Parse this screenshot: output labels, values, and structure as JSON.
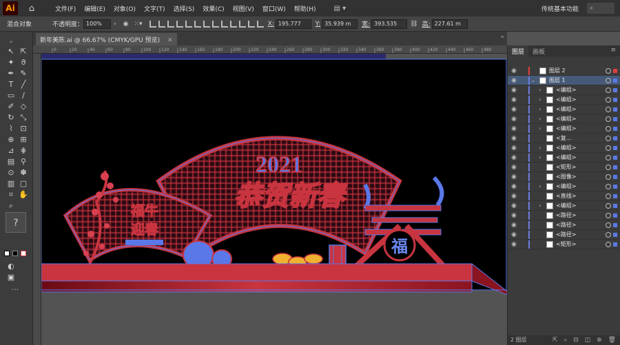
{
  "app": {
    "logo": "Ai",
    "home_icon": "home-icon"
  },
  "menu": [
    "文件(F)",
    "编辑(E)",
    "对象(O)",
    "文字(T)",
    "选择(S)",
    "效果(C)",
    "视图(V)",
    "窗口(W)",
    "帮助(H)"
  ],
  "workspace": {
    "name": "传统基本功能",
    "search_placeholder": "搜索"
  },
  "control_bar": {
    "mode": "混合对象",
    "opacity_label": "不透明度：",
    "opacity_value": "100%",
    "x_label": "X:",
    "x_value": "195.777",
    "y_label": "Y:",
    "y_value": "35.939 m",
    "w_label": "宽:",
    "w_value": "393.535",
    "h_label": "高:",
    "h_value": "227.61 m"
  },
  "document": {
    "tab_label": "新年美陈.ai @ 66.67% (CMYK/GPU 预览)"
  },
  "ruler": {
    "ticks": [
      "0",
      "20",
      "40",
      "60",
      "80",
      "100",
      "120",
      "140",
      "160",
      "180",
      "200",
      "220",
      "240",
      "260",
      "280",
      "300",
      "320",
      "340",
      "360",
      "380",
      "400",
      "420",
      "440",
      "460",
      "480"
    ]
  },
  "artwork": {
    "year": "2021",
    "greeting": "恭贺新春",
    "small_text_1": "福牛",
    "small_text_2": "迎春",
    "fu": "福",
    "colors": {
      "red": "#c8343f",
      "blue": "#5a78e8",
      "gold": "#f0b030",
      "bg": "#000000"
    }
  },
  "layers_panel": {
    "tabs": [
      "图层",
      "画板"
    ],
    "rows": [
      {
        "name": "图层 2",
        "level": 0,
        "arrow": "",
        "color": "red"
      },
      {
        "name": "图层 1",
        "level": 0,
        "arrow": "⌄",
        "color": "blue",
        "selected": true
      },
      {
        "name": "<编组>",
        "level": 1,
        "arrow": "›"
      },
      {
        "name": "<编组>",
        "level": 1,
        "arrow": "›"
      },
      {
        "name": "<编组>",
        "level": 1,
        "arrow": "›"
      },
      {
        "name": "<编组>",
        "level": 1,
        "arrow": "›"
      },
      {
        "name": "<编组>",
        "level": 1,
        "arrow": "›"
      },
      {
        "name": "<复...",
        "level": 1,
        "arrow": ""
      },
      {
        "name": "<编组>",
        "level": 1,
        "arrow": "›"
      },
      {
        "name": "<编组>",
        "level": 1,
        "arrow": "›"
      },
      {
        "name": "<矩形>",
        "level": 1,
        "arrow": ""
      },
      {
        "name": "<图像>",
        "level": 1,
        "arrow": ""
      },
      {
        "name": "<编组>",
        "level": 1,
        "arrow": "›"
      },
      {
        "name": "<直线>",
        "level": 1,
        "arrow": ""
      },
      {
        "name": "<编组>",
        "level": 1,
        "arrow": "›"
      },
      {
        "name": "<路径>",
        "level": 1,
        "arrow": ""
      },
      {
        "name": "<路径>",
        "level": 1,
        "arrow": ""
      },
      {
        "name": "<路径>",
        "level": 1,
        "arrow": ""
      },
      {
        "name": "<矩形>",
        "level": 1,
        "arrow": ""
      }
    ],
    "footer": "2 图层"
  }
}
